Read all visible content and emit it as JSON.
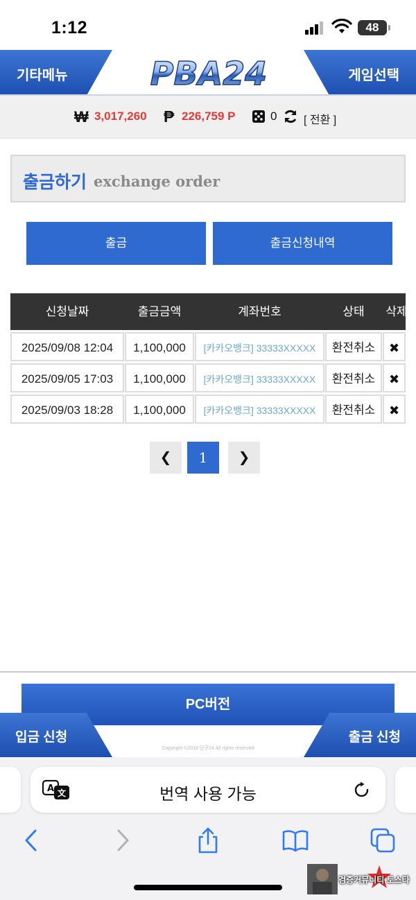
{
  "status_bar": {
    "time": "1:12",
    "battery": "48"
  },
  "header": {
    "left_menu": "기타메뉴",
    "right_menu": "게임선택",
    "logo_text": "PBA24"
  },
  "balance": {
    "won_symbol": "₩",
    "won_amount": "3,017,260",
    "point_symbol": "₱",
    "point_amount": "226,759 P",
    "dice_count": "0",
    "convert_label": "[ 전환 ]"
  },
  "section": {
    "title_ko": "출금하기",
    "title_en": "exchange order"
  },
  "actions": {
    "withdraw": "출금",
    "history": "출금신청내역"
  },
  "table": {
    "headers": [
      "신청날짜",
      "출금금액",
      "계좌번호",
      "상태",
      "삭제"
    ],
    "rows": [
      {
        "date": "2025/09/08 12:04",
        "amount": "1,100,000",
        "account": "[카카오뱅크] 33333XXXXX",
        "status": "환전취소",
        "delete": "✖"
      },
      {
        "date": "2025/09/05 17:03",
        "amount": "1,100,000",
        "account": "[카카오뱅크] 33333XXXXX",
        "status": "환전취소",
        "delete": "✖"
      },
      {
        "date": "2025/09/03 18:28",
        "amount": "1,100,000",
        "account": "[카카오뱅크] 33333XXXXX",
        "status": "환전취소",
        "delete": "✖"
      }
    ]
  },
  "pagination": {
    "prev": "❮",
    "current": "1",
    "next": "❯"
  },
  "footer": {
    "pc_version": "PC버전",
    "copyright": "Copyright ©2018 당구24 All rights reserved",
    "deposit": "입금 신청",
    "withdraw": "출금 신청"
  },
  "browser": {
    "url_text": "번역 사용 가능"
  },
  "watermark": {
    "text": "검증커뮤니티 토스타"
  },
  "colors": {
    "brand_blue": "#2f6ad1",
    "amount_red": "#e53935",
    "header_dark": "#333333",
    "account_link": "#6aa7d8"
  }
}
